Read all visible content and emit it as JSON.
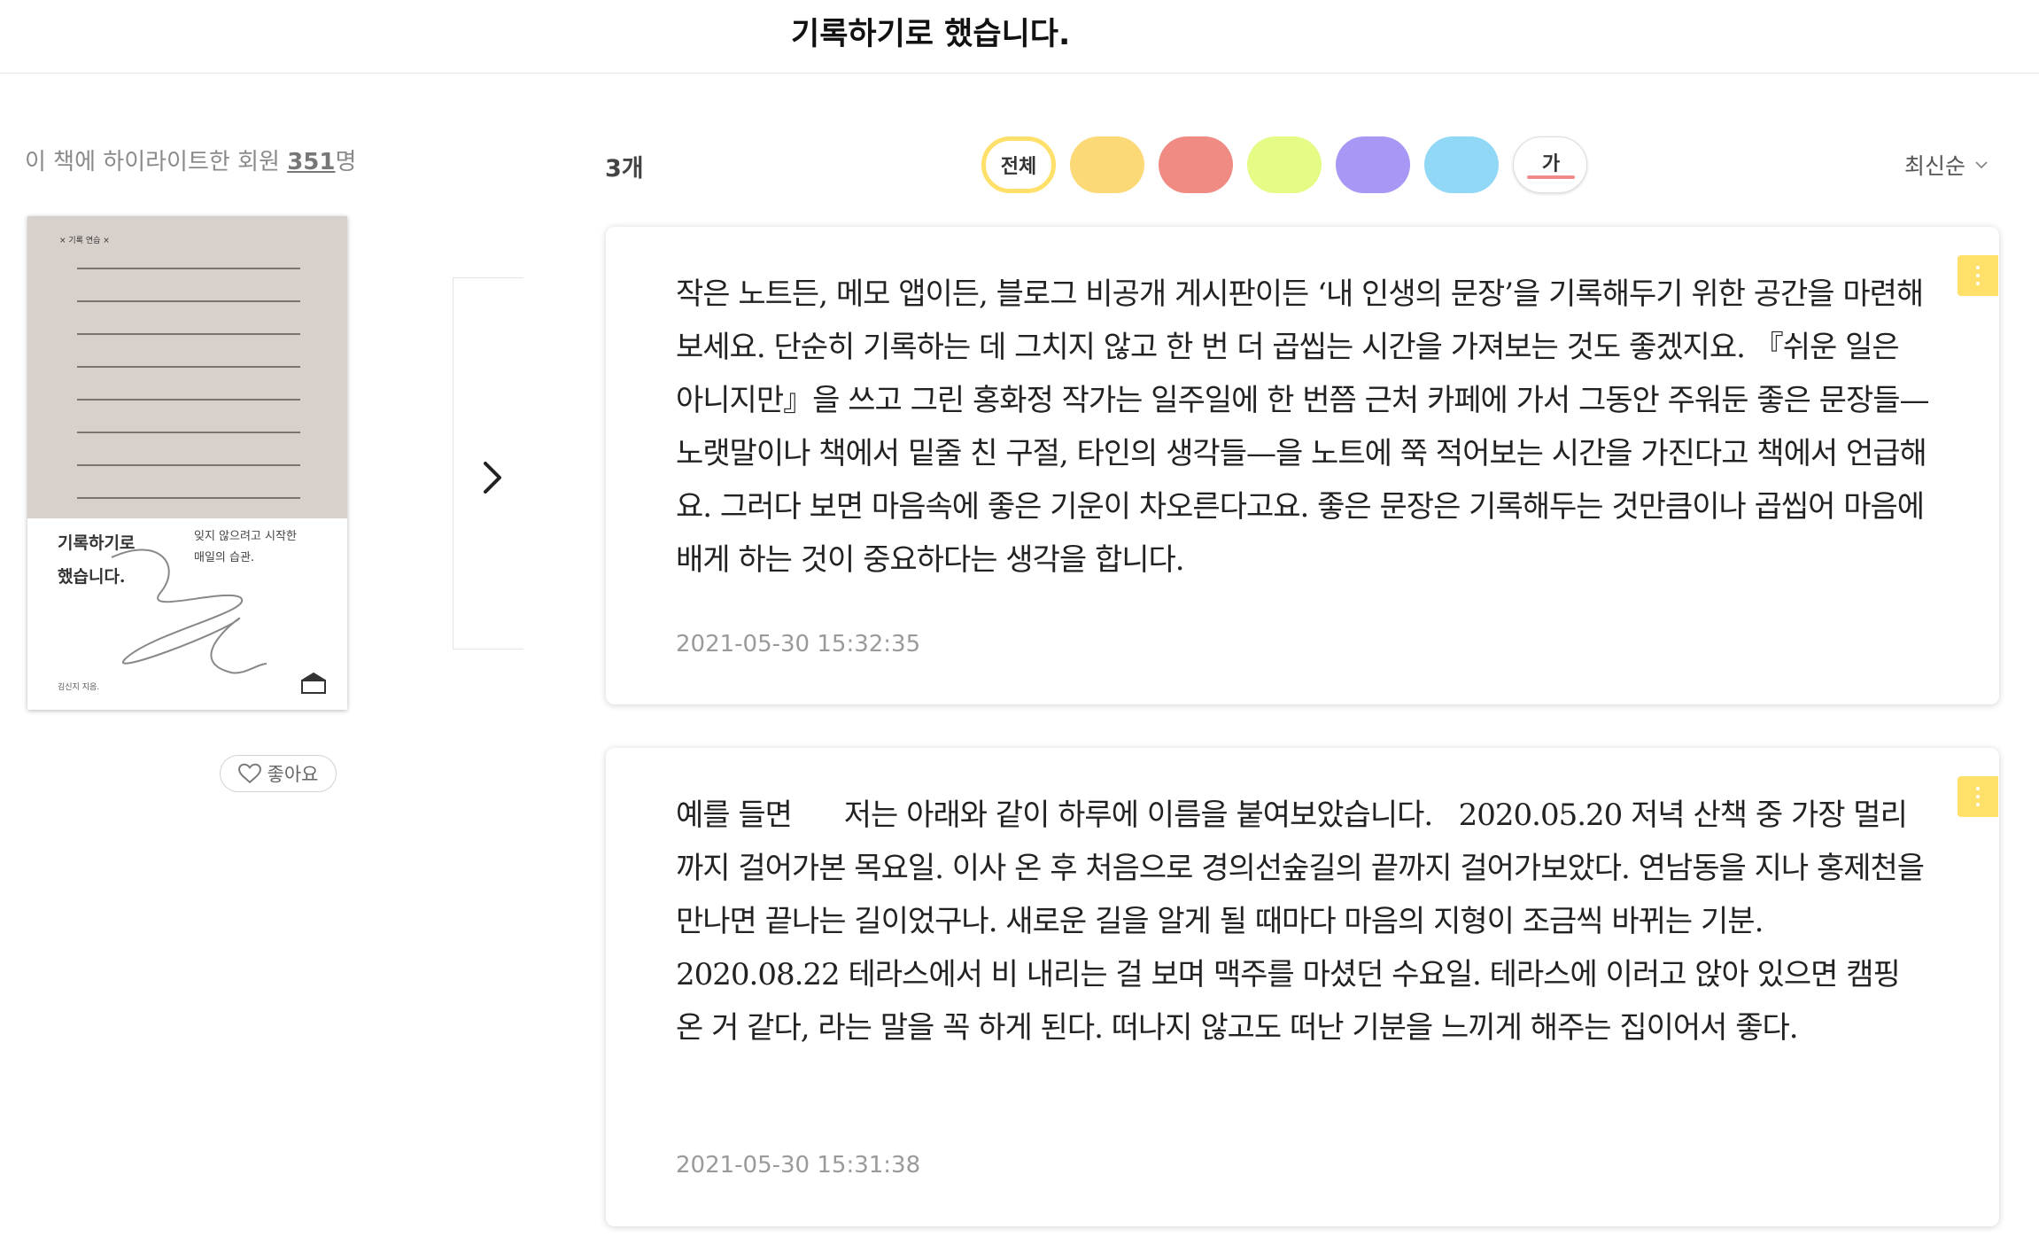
{
  "header": {
    "title": "기록하기로 했습니다."
  },
  "sidebar": {
    "highlight_prefix": "이 책에 하이라이트한 회원 ",
    "highlight_count": "351",
    "highlight_suffix": "명",
    "book": {
      "series": "×  기록 연습  ×",
      "title": "기록하기로\n했습니다.",
      "subtitle": "잊지 않으려고 시작한\n매일의 습관.",
      "author": "김신지 지음."
    },
    "like_label": "좋아요"
  },
  "filters": {
    "count_label": "3개",
    "all_label": "전체",
    "text_chip_label": "가",
    "colors": [
      "#fbd977",
      "#ef8b82",
      "#e4fb85",
      "#a897f4",
      "#91d8f7"
    ],
    "selected_ring_color": "#ffe06a",
    "sort_label": "최신순"
  },
  "highlights": [
    {
      "text": "작은 노트든, 메모 앱이든, 블로그 비공개 게시판이든 ‘내 인생의 문장’을 기록해두기 위한 공간을 마련해보세요. 단순히 기록하는 데 그치지 않고 한 번 더 곱씹는 시간을 가져보는 것도 좋겠지요. 『쉬운 일은 아니지만』을 쓰고 그린 홍화정 작가는 일주일에 한 번쯤 근처 카페에 가서 그동안 주워둔 좋은 문장들—노랫말이나 책에서 밑줄 친 구절, 타인의 생각들—을 노트에 쭉 적어보는 시간을 가진다고 책에서 언급해요. 그러다 보면 마음속에 좋은 기운이 차오른다고요. 좋은 문장은 기록해두는 것만큼이나 곱씹어 마음에 배게 하는 것이 중요하다는 생각을 합니다.",
      "date": "2021-05-30 15:32:35",
      "color": "#ffe06a"
    },
    {
      "text": "예를 들면      저는 아래와 같이 하루에 이름을 붙여보았습니다.   2020.05.20 저녁 산책 중 가장 멀리까지 걸어가본 목요일. 이사 온 후 처음으로 경의선숲길의 끝까지 걸어가보았다. 연남동을 지나 홍제천을 만나면 끝나는 길이었구나. 새로운 길을 알게 될 때마다 마음의 지형이 조금씩 바뀌는 기분.   2020.08.22 테라스에서 비 내리는 걸 보며 맥주를 마셨던 수요일. 테라스에 이러고 앉아 있으면 캠핑 온 거 같다, 라는 말을 꼭 하게 된다. 떠나지 않고도 떠난 기분을 느끼게 해주는 집이어서 좋다.",
      "date": "2021-05-30 15:31:38",
      "color": "#ffe06a"
    }
  ]
}
